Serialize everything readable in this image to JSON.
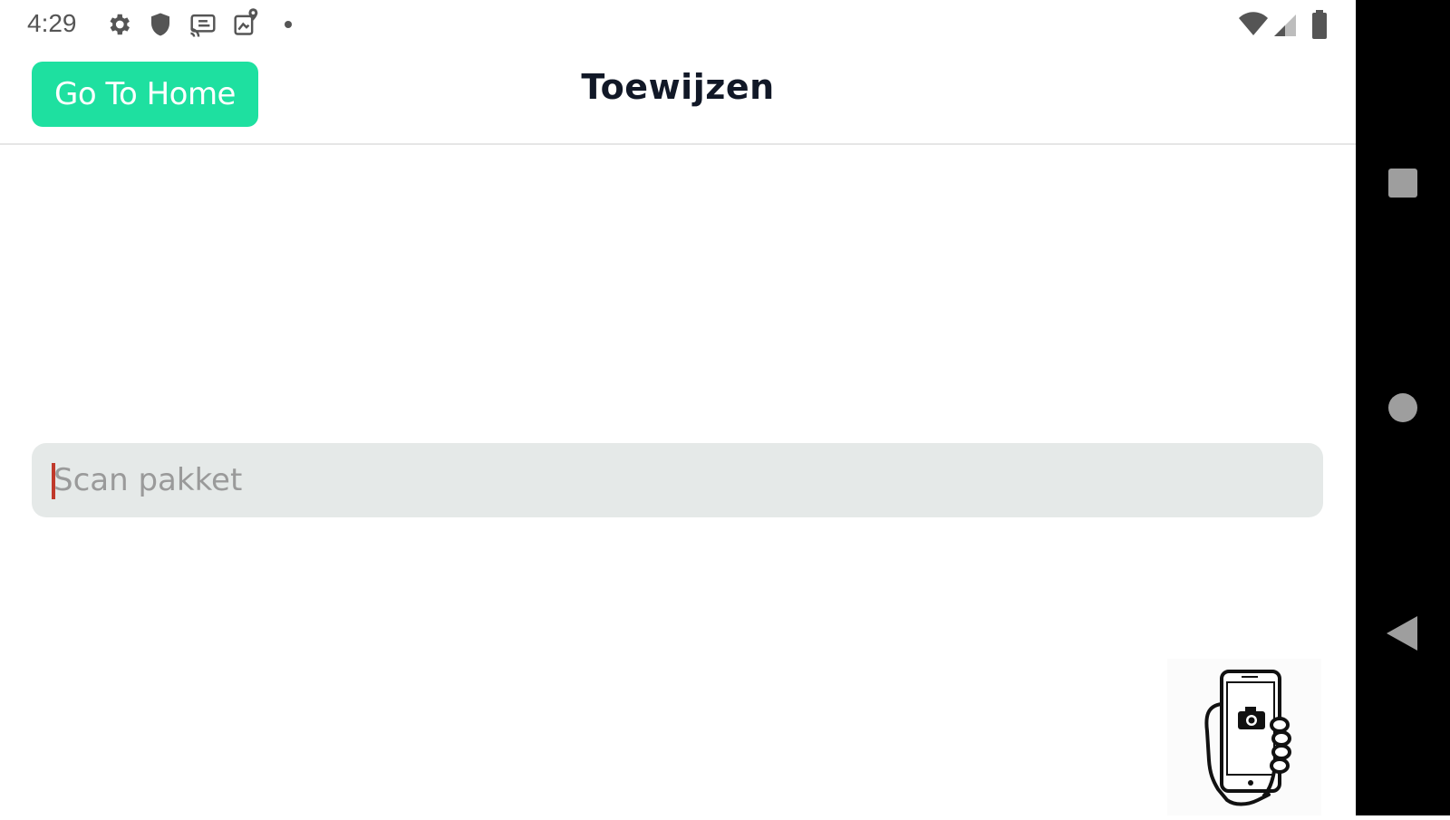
{
  "status_bar": {
    "time": "4:29",
    "left_icons": [
      "gear-icon",
      "shield-icon",
      "cast-icon",
      "location-sim-icon",
      "notification-dot-icon"
    ],
    "right_icons": [
      "wifi-icon",
      "signal-icon",
      "battery-icon"
    ]
  },
  "header": {
    "home_button_label": "Go To Home",
    "title": "Toewijzen"
  },
  "scan": {
    "placeholder": "Scan pakket",
    "value": ""
  },
  "camera_button": {
    "icon": "phone-camera-scan-icon"
  },
  "nav_bar": {
    "buttons": [
      "recents-button",
      "home-button",
      "back-button"
    ]
  },
  "colors": {
    "accent": "#1ee0a0",
    "input_bg": "#e5e9e8",
    "title_text": "#111827",
    "caret": "#c0392b",
    "nav_bg": "#000000",
    "nav_icon": "#9e9e9e"
  }
}
